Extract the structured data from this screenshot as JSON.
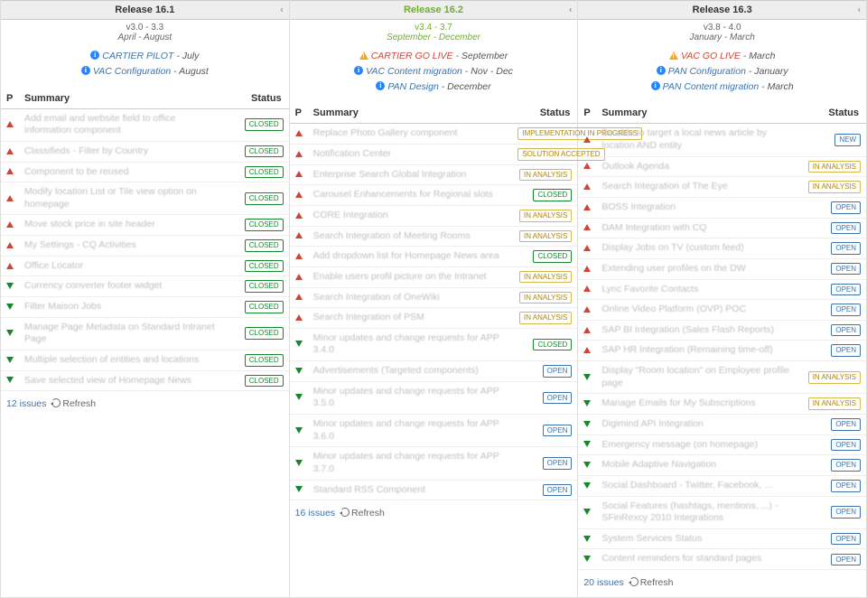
{
  "headers": {
    "p": "P",
    "summary": "Summary",
    "status": "Status"
  },
  "refresh_label": "Refresh",
  "issues_suffix": "issues",
  "status_labels": {
    "CLOSED": "CLOSED",
    "OPEN": "OPEN",
    "NEW": "NEW",
    "IN_ANALYSIS": "IN ANALYSIS",
    "IMPL_PROG": "IMPLEMENTATION IN PROGRESS",
    "SOL_ACC": "SOLUTION ACCEPTED"
  },
  "columns": [
    {
      "title": "Release 16.1",
      "active": false,
      "versions": "v3.0 - 3.3",
      "daterange": "April - August",
      "milestones": [
        {
          "type": "info",
          "name": "CARTIER PILOT",
          "when": "July"
        },
        {
          "type": "info",
          "name": "VAC Configuration",
          "when": "August"
        }
      ],
      "issues": [
        {
          "p": "up",
          "summary": "Add email and website field to office information component",
          "status": "CLOSED"
        },
        {
          "p": "up",
          "summary": "Classifieds - Filter by Country",
          "status": "CLOSED"
        },
        {
          "p": "up",
          "summary": "Component to be reused",
          "status": "CLOSED"
        },
        {
          "p": "up",
          "summary": "Modify location List or Tile view option on homepage",
          "status": "CLOSED"
        },
        {
          "p": "up",
          "summary": "Move stock price in site header",
          "status": "CLOSED"
        },
        {
          "p": "up",
          "summary": "My Settings - CQ Activities",
          "status": "CLOSED"
        },
        {
          "p": "up",
          "summary": "Office Locator",
          "status": "CLOSED"
        },
        {
          "p": "down",
          "summary": "Currency converter footer widget",
          "status": "CLOSED"
        },
        {
          "p": "down",
          "summary": "Filter Maison Jobs",
          "status": "CLOSED"
        },
        {
          "p": "down",
          "summary": "Manage Page Metadata on Standard Intranet Page",
          "status": "CLOSED"
        },
        {
          "p": "down",
          "summary": "Multiple selection of entities and locations",
          "status": "CLOSED"
        },
        {
          "p": "down",
          "summary": "Save selected view of Homepage News",
          "status": "CLOSED"
        }
      ],
      "count": "12"
    },
    {
      "title": "Release 16.2",
      "active": true,
      "versions": "v3.4 - 3.7",
      "daterange": "September - December",
      "milestones": [
        {
          "type": "warn",
          "name": "CARTIER GO LIVE",
          "when": "September"
        },
        {
          "type": "info",
          "name": "VAC Content migration",
          "when": "Nov - Dec"
        },
        {
          "type": "info",
          "name": "PAN Design",
          "when": "December"
        }
      ],
      "issues": [
        {
          "p": "up",
          "summary": "Replace Photo Gallery component",
          "status": "IMPL_PROG"
        },
        {
          "p": "up",
          "summary": "Notification Center",
          "status": "SOL_ACC"
        },
        {
          "p": "up",
          "summary": "Enterprise Search Global Integration",
          "status": "IN_ANALYSIS"
        },
        {
          "p": "up",
          "summary": "Carousel Enhancements for Regional slots",
          "status": "CLOSED"
        },
        {
          "p": "up",
          "summary": "CORE Integration",
          "status": "IN_ANALYSIS"
        },
        {
          "p": "up",
          "summary": "Search Integration of Meeting Rooms",
          "status": "IN_ANALYSIS"
        },
        {
          "p": "up",
          "summary": "Add dropdown list for Homepage News area",
          "status": "CLOSED"
        },
        {
          "p": "up",
          "summary": "Enable users profil picture on the Intranet",
          "status": "IN_ANALYSIS"
        },
        {
          "p": "up",
          "summary": "Search Integration of OneWiki",
          "status": "IN_ANALYSIS"
        },
        {
          "p": "up",
          "summary": "Search Integration of PSM",
          "status": "IN_ANALYSIS"
        },
        {
          "p": "down",
          "summary": "Minor updates and change requests for APP 3.4.0",
          "status": "CLOSED"
        },
        {
          "p": "down",
          "summary": "Advertisements (Targeted components)",
          "status": "OPEN"
        },
        {
          "p": "down",
          "summary": "Minor updates and change requests for APP 3.5.0",
          "status": "OPEN"
        },
        {
          "p": "down",
          "summary": "Minor updates and change requests for APP 3.6.0",
          "status": "OPEN"
        },
        {
          "p": "down",
          "summary": "Minor updates and change requests for APP 3.7.0",
          "status": "OPEN"
        },
        {
          "p": "down",
          "summary": "Standard RSS Component",
          "status": "OPEN"
        }
      ],
      "count": "16"
    },
    {
      "title": "Release 16.3",
      "active": false,
      "versions": "v3.8 - 4.0",
      "daterange": "January - March",
      "milestones": [
        {
          "type": "warn",
          "name": "VAC GO LIVE",
          "when": "March"
        },
        {
          "type": "info",
          "name": "PAN Configuration",
          "when": "January"
        },
        {
          "type": "info",
          "name": "PAN Content migration",
          "when": "March"
        }
      ],
      "issues": [
        {
          "p": "up",
          "summary": "Be able to target a local news article by location AND entity",
          "status": "NEW"
        },
        {
          "p": "up",
          "summary": "Outlook Agenda",
          "status": "IN_ANALYSIS"
        },
        {
          "p": "up",
          "summary": "Search Integration of The Eye",
          "status": "IN_ANALYSIS"
        },
        {
          "p": "up",
          "summary": "BOSS Integration",
          "status": "OPEN"
        },
        {
          "p": "up",
          "summary": "DAM Integration with CQ",
          "status": "OPEN"
        },
        {
          "p": "up",
          "summary": "Display Jobs on TV (custom feed)",
          "status": "OPEN"
        },
        {
          "p": "up",
          "summary": "Extending user profiles on the DW",
          "status": "OPEN"
        },
        {
          "p": "up",
          "summary": "Lync Favorite Contacts",
          "status": "OPEN"
        },
        {
          "p": "up",
          "summary": "Online Video Platform (OVP) POC",
          "status": "OPEN"
        },
        {
          "p": "up",
          "summary": "SAP BI Integration (Sales Flash Reports)",
          "status": "OPEN"
        },
        {
          "p": "up",
          "summary": "SAP HR Integration (Remaining time-off)",
          "status": "OPEN"
        },
        {
          "p": "down",
          "summary": "Display \"Room location\" on Employee profile page",
          "status": "IN_ANALYSIS"
        },
        {
          "p": "down",
          "summary": "Manage Emails for My Subscriptions",
          "status": "IN_ANALYSIS"
        },
        {
          "p": "down",
          "summary": "Digimind API Integration",
          "status": "OPEN"
        },
        {
          "p": "down",
          "summary": "Emergency message (on homepage)",
          "status": "OPEN"
        },
        {
          "p": "down",
          "summary": "Mobile Adaptive Navigation",
          "status": "OPEN"
        },
        {
          "p": "down",
          "summary": "Social Dashboard - Twitter, Facebook, ...",
          "status": "OPEN"
        },
        {
          "p": "down",
          "summary": "Social Features (hashtags, mentions, ...) - SFinRexcy 2010 Integrations",
          "status": "OPEN"
        },
        {
          "p": "down",
          "summary": "System Services Status",
          "status": "OPEN"
        },
        {
          "p": "down",
          "summary": "Content reminders for standard pages",
          "status": "OPEN"
        }
      ],
      "count": "20"
    }
  ]
}
